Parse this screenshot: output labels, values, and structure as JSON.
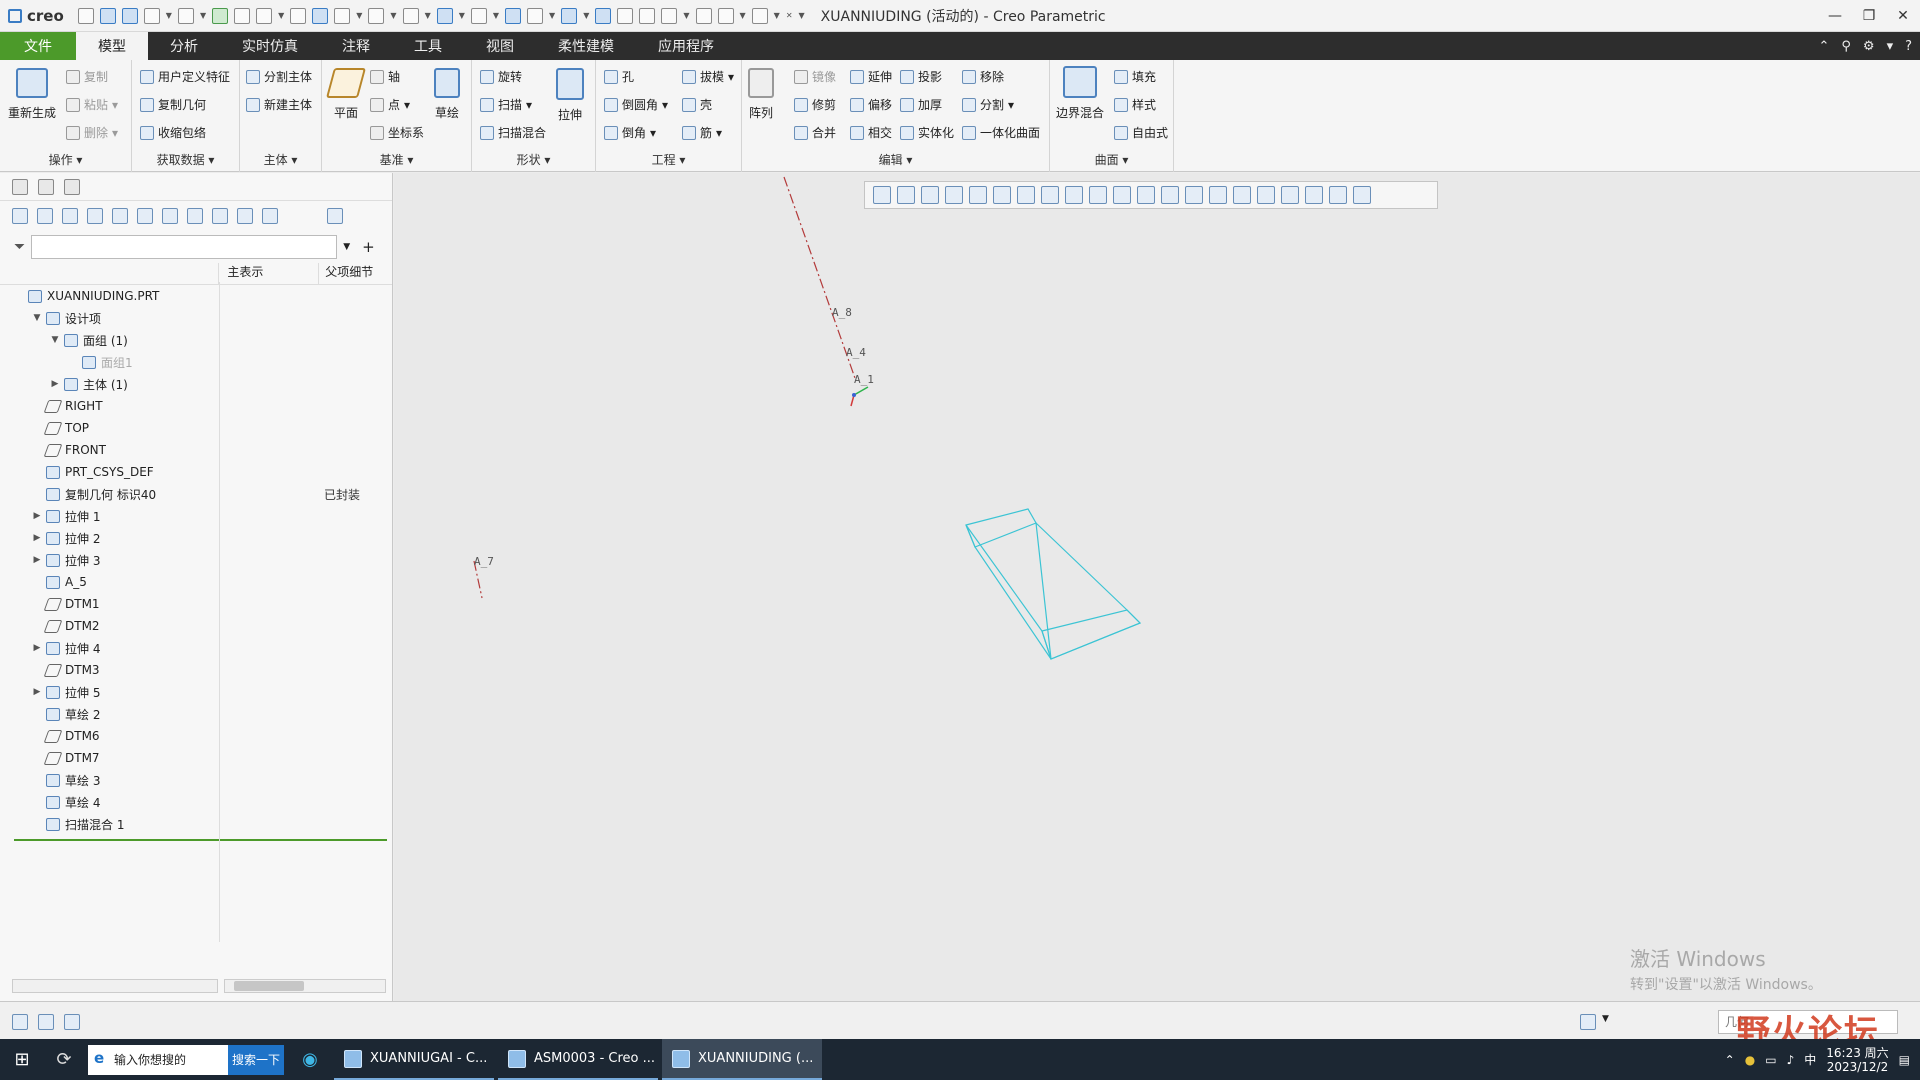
{
  "app": {
    "logo": "creo",
    "window_title": "XUANNIUDING (活动的) - Creo Parametric"
  },
  "menu": {
    "tabs": [
      "文件",
      "模型",
      "分析",
      "实时仿真",
      "注释",
      "工具",
      "视图",
      "柔性建模",
      "应用程序"
    ],
    "active_tab": "模型"
  },
  "ribbon": {
    "operations": {
      "label": "操作",
      "regenerate": "重新生成",
      "copy": "复制",
      "paste": "粘贴",
      "delete": "删除"
    },
    "get_data": {
      "label": "获取数据",
      "udf": "用户定义特征",
      "copy_geom": "复制几何",
      "shrinkwrap": "收缩包络"
    },
    "body": {
      "label": "主体",
      "split_body": "分割主体",
      "new_body": "新建主体"
    },
    "datum": {
      "label": "基准",
      "plane": "平面",
      "axis": "轴",
      "point": "点",
      "csys": "坐标系",
      "sketch": "草绘"
    },
    "shapes": {
      "label": "形状",
      "revolve": "旋转",
      "sweep": "扫描",
      "swept_blend": "扫描混合",
      "extrude": "拉伸"
    },
    "engineering": {
      "label": "工程",
      "hole": "孔",
      "round": "倒圆角",
      "chamfer": "倒角",
      "draft": "拔模",
      "shell": "壳",
      "rib": "筋"
    },
    "editing": {
      "label": "编辑",
      "pattern": "阵列",
      "mirror": "镜像",
      "trim": "修剪",
      "merge": "合并",
      "extend": "延伸",
      "offset": "偏移",
      "intersect": "相交",
      "project": "投影",
      "thicken": "加厚",
      "solidify": "实体化",
      "remove": "移除",
      "split": "分割",
      "unify_surface": "一体化曲面"
    },
    "surfaces": {
      "label": "曲面",
      "boundary_blend": "边界混合",
      "fill": "填充",
      "style": "样式",
      "freestyle": "自由式"
    }
  },
  "model_tree": {
    "search_placeholder": "",
    "columns": [
      "主表示",
      "父项细节"
    ],
    "rows": [
      {
        "label": "XUANNIUDING.PRT",
        "indent": 0,
        "expander": "",
        "note": "",
        "dim": false
      },
      {
        "label": "设计项",
        "indent": 1,
        "expander": "▼",
        "note": "",
        "dim": false
      },
      {
        "label": "面组 (1)",
        "indent": 2,
        "expander": "▼",
        "note": "",
        "dim": false
      },
      {
        "label": "面组1",
        "indent": 3,
        "expander": "",
        "note": "",
        "dim": true
      },
      {
        "label": "主体 (1)",
        "indent": 2,
        "expander": "▶",
        "note": "",
        "dim": false
      },
      {
        "label": "RIGHT",
        "indent": 1,
        "expander": "",
        "note": "",
        "dim": false,
        "plane": true
      },
      {
        "label": "TOP",
        "indent": 1,
        "expander": "",
        "note": "",
        "dim": false,
        "plane": true
      },
      {
        "label": "FRONT",
        "indent": 1,
        "expander": "",
        "note": "",
        "dim": false,
        "plane": true
      },
      {
        "label": "PRT_CSYS_DEF",
        "indent": 1,
        "expander": "",
        "note": "",
        "dim": false
      },
      {
        "label": "复制几何 标识40",
        "indent": 1,
        "expander": "",
        "note": "已封装",
        "dim": false
      },
      {
        "label": "拉伸 1",
        "indent": 1,
        "expander": "▶",
        "note": "",
        "dim": false
      },
      {
        "label": "拉伸 2",
        "indent": 1,
        "expander": "▶",
        "note": "",
        "dim": false
      },
      {
        "label": "拉伸 3",
        "indent": 1,
        "expander": "▶",
        "note": "",
        "dim": false
      },
      {
        "label": "A_5",
        "indent": 1,
        "expander": "",
        "note": "",
        "dim": false
      },
      {
        "label": "DTM1",
        "indent": 1,
        "expander": "",
        "note": "",
        "dim": false,
        "plane": true
      },
      {
        "label": "DTM2",
        "indent": 1,
        "expander": "",
        "note": "",
        "dim": false,
        "plane": true
      },
      {
        "label": "拉伸 4",
        "indent": 1,
        "expander": "▶",
        "note": "",
        "dim": false
      },
      {
        "label": "DTM3",
        "indent": 1,
        "expander": "",
        "note": "",
        "dim": false,
        "plane": true
      },
      {
        "label": "拉伸 5",
        "indent": 1,
        "expander": "▶",
        "note": "",
        "dim": false
      },
      {
        "label": "草绘 2",
        "indent": 1,
        "expander": "",
        "note": "",
        "dim": false
      },
      {
        "label": "DTM6",
        "indent": 1,
        "expander": "",
        "note": "",
        "dim": false,
        "plane": true
      },
      {
        "label": "DTM7",
        "indent": 1,
        "expander": "",
        "note": "",
        "dim": false,
        "plane": true
      },
      {
        "label": "草绘 3",
        "indent": 1,
        "expander": "",
        "note": "",
        "dim": false
      },
      {
        "label": "草绘 4",
        "indent": 1,
        "expander": "",
        "note": "",
        "dim": false
      },
      {
        "label": "扫描混合 1",
        "indent": 1,
        "expander": "",
        "note": "",
        "dim": false
      }
    ]
  },
  "graphics": {
    "axis_labels": [
      "A_8",
      "A_4",
      "A_1",
      "A_7"
    ],
    "watermark_line1": "激活 Windows",
    "watermark_line2": "转到\"设置\"以激活 Windows。",
    "geometry_color": "#3cc4d4",
    "axis_color": "#b33a3a"
  },
  "statusbar": {
    "filter_value": "几何"
  },
  "forum_logo": "野火论坛",
  "taskbar": {
    "search_placeholder": "输入你想搜的",
    "search_button": "搜索一下",
    "apps": [
      "XUANNIUGAI - C...",
      "ASM0003 - Creo ...",
      "XUANNIUDING (..."
    ],
    "time": "16:23 周六",
    "date": "2023/12/2"
  },
  "colors": {
    "file_tab": "#4c9a2a",
    "menubar": "#2d2d2d",
    "taskbar": "#1c2733"
  }
}
